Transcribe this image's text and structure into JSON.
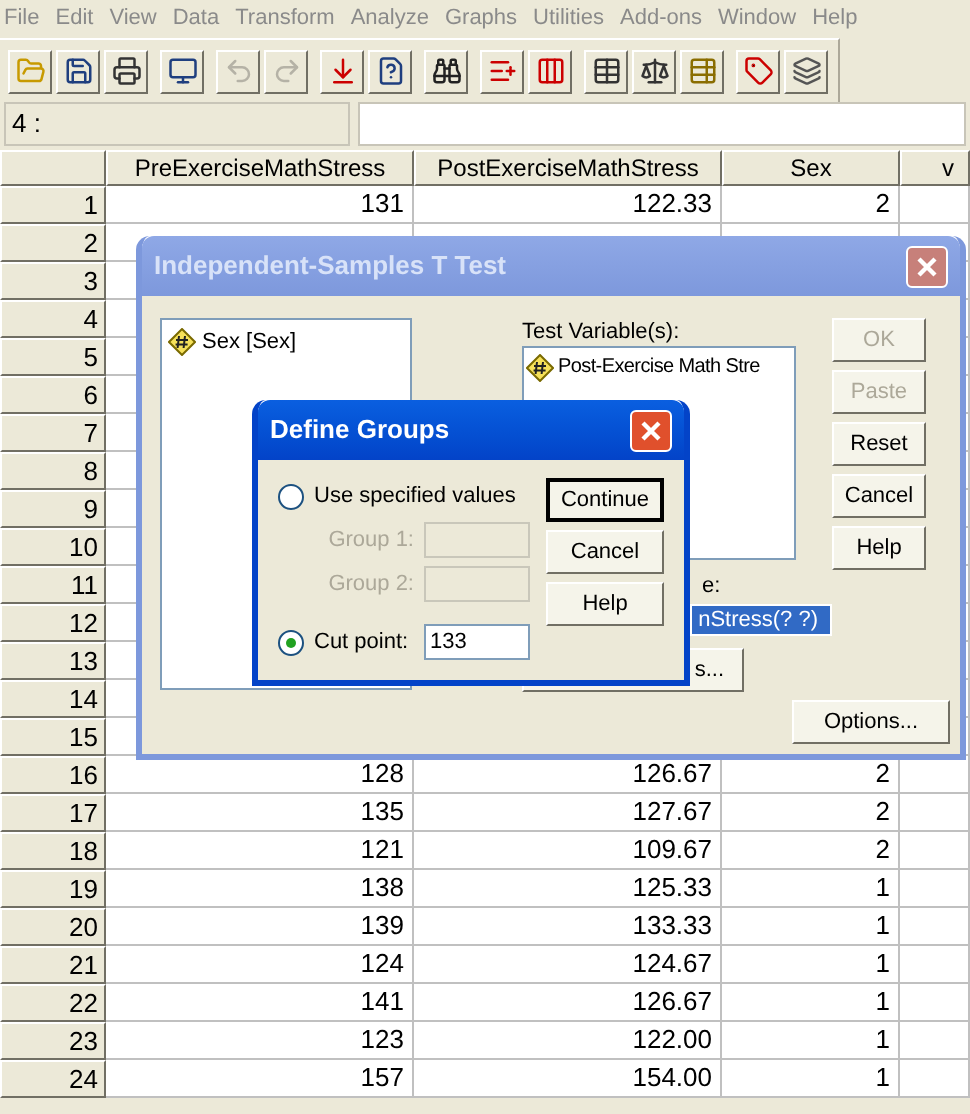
{
  "menu": [
    "File",
    "Edit",
    "View",
    "Data",
    "Transform",
    "Analyze",
    "Graphs",
    "Utilities",
    "Add-ons",
    "Window",
    "Help"
  ],
  "toolbar": [
    [
      {
        "disabled": false
      },
      {
        "disabled": false
      },
      {
        "disabled": false
      }
    ],
    [
      {
        "disabled": false
      }
    ],
    [
      {
        "disabled": true
      },
      {
        "disabled": true
      }
    ],
    [
      {
        "disabled": false
      },
      {
        "disabled": false
      }
    ],
    [
      {
        "disabled": false
      }
    ],
    [
      {
        "disabled": false
      },
      {
        "disabled": false
      }
    ],
    [
      {
        "disabled": false
      },
      {
        "disabled": false
      },
      {
        "disabled": false
      }
    ],
    [
      {
        "disabled": false
      },
      {
        "disabled": false
      }
    ]
  ],
  "cell_editor": {
    "cell_ref": "4 :"
  },
  "grid": {
    "columns": [
      "PreExerciseMathStress",
      "PostExerciseMathStress",
      "Sex",
      "v"
    ],
    "rows": [
      {
        "row": "1",
        "cells": [
          "131",
          "122.33",
          "2"
        ]
      },
      {
        "row": "2"
      },
      {
        "row": "3"
      },
      {
        "row": "4"
      },
      {
        "row": "5"
      },
      {
        "row": "6"
      },
      {
        "row": "7"
      },
      {
        "row": "8"
      },
      {
        "row": "9"
      },
      {
        "row": "10"
      },
      {
        "row": "11"
      },
      {
        "row": "12"
      },
      {
        "row": "13"
      },
      {
        "row": "14"
      },
      {
        "row": "15"
      },
      {
        "row": "16",
        "cells": [
          "128",
          "126.67",
          "2"
        ]
      },
      {
        "row": "17",
        "cells": [
          "135",
          "127.67",
          "2"
        ]
      },
      {
        "row": "18",
        "cells": [
          "121",
          "109.67",
          "2"
        ]
      },
      {
        "row": "19",
        "cells": [
          "138",
          "125.33",
          "1"
        ]
      },
      {
        "row": "20",
        "cells": [
          "139",
          "133.33",
          "1"
        ]
      },
      {
        "row": "21",
        "cells": [
          "124",
          "124.67",
          "1"
        ]
      },
      {
        "row": "22",
        "cells": [
          "141",
          "126.67",
          "1"
        ]
      },
      {
        "row": "23",
        "cells": [
          "123",
          "122.00",
          "1"
        ]
      },
      {
        "row": "24",
        "cells": [
          "157",
          "154.00",
          "1"
        ]
      }
    ]
  },
  "t_test_dialog": {
    "title": "Independent-Samples T Test",
    "active": false,
    "source_list": [
      "Sex [Sex]"
    ],
    "test_variables_label": "Test Variable(s):",
    "test_variables": [
      "Post-Exercise Math Stre"
    ],
    "grouping_label": "e:",
    "grouping_value": "nStress(? ?)",
    "define_groups_button": "s...",
    "options_button": "Options...",
    "buttons": [
      {
        "label": "OK",
        "disabled": true
      },
      {
        "label": "Paste",
        "disabled": true
      },
      {
        "label": "Reset",
        "disabled": false
      },
      {
        "label": "Cancel",
        "disabled": false
      },
      {
        "label": "Help",
        "disabled": false
      }
    ]
  },
  "define_groups_dialog": {
    "title": "Define Groups",
    "active": true,
    "specified": {
      "label": "Use specified values",
      "selected": false,
      "fields": [
        {
          "label": "Group 1:",
          "disabled": true
        },
        {
          "label": "Group 2:",
          "disabled": true
        }
      ]
    },
    "cut_point": {
      "label": "Cut point:",
      "selected": true,
      "value": "133"
    },
    "buttons": [
      {
        "label": "Continue",
        "default": true
      },
      {
        "label": "Cancel",
        "default": false
      },
      {
        "label": "Help",
        "default": false
      }
    ]
  }
}
